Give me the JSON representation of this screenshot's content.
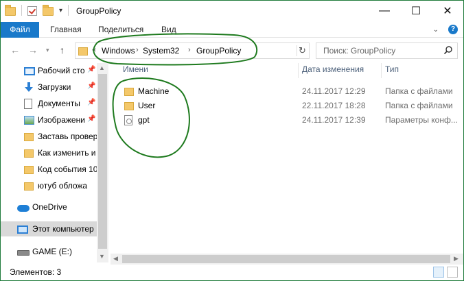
{
  "window": {
    "title": "GroupPolicy",
    "controls": {
      "minimize": "—",
      "maximize": "☐",
      "close": "✕"
    }
  },
  "ribbon": {
    "tabs": [
      {
        "label": "Файл"
      },
      {
        "label": "Главная"
      },
      {
        "label": "Поделиться"
      },
      {
        "label": "Вид"
      }
    ]
  },
  "address": {
    "overflow": "«",
    "crumbs": [
      "Windows",
      "System32",
      "GroupPolicy"
    ],
    "separator": "›"
  },
  "search": {
    "placeholder": "Поиск: GroupPolicy"
  },
  "navpane": {
    "items": [
      {
        "label": "Рабочий сто",
        "icon": "desktop-icon",
        "pinned": true
      },
      {
        "label": "Загрузки",
        "icon": "downloads-icon",
        "pinned": true
      },
      {
        "label": "Документы",
        "icon": "documents-icon",
        "pinned": true
      },
      {
        "label": "Изображени",
        "icon": "pictures-icon",
        "pinned": true
      },
      {
        "label": "Заставь провер",
        "icon": "folder-icon",
        "pinned": false
      },
      {
        "label": "Как изменить и",
        "icon": "folder-icon",
        "pinned": false
      },
      {
        "label": "Код события 10",
        "icon": "folder-icon",
        "pinned": false
      },
      {
        "label": "ютуб обложа",
        "icon": "folder-icon",
        "pinned": false
      },
      {
        "label": "OneDrive",
        "icon": "onedrive-icon",
        "pinned": false
      },
      {
        "label": "Этот компьютер",
        "icon": "this-pc-icon",
        "pinned": false,
        "selected": true
      },
      {
        "label": "GAME (E:)",
        "icon": "drive-icon",
        "pinned": false
      }
    ]
  },
  "columns": {
    "name": "Имени",
    "date": "Дата изменения",
    "type": "Тип"
  },
  "files": [
    {
      "name": "Machine",
      "date": "24.11.2017 12:29",
      "type": "Папка с файлами",
      "icon": "folder-icon"
    },
    {
      "name": "User",
      "date": "22.11.2017 18:28",
      "type": "Папка с файлами",
      "icon": "folder-icon"
    },
    {
      "name": "gpt",
      "date": "24.11.2017 12:39",
      "type": "Параметры конф...",
      "icon": "config-file-icon"
    }
  ],
  "status": {
    "text": "Элементов: 3"
  },
  "colors": {
    "file_tab": "#1979ca",
    "annotation": "#1e7a1e",
    "window_border": "#1e7a3a"
  }
}
